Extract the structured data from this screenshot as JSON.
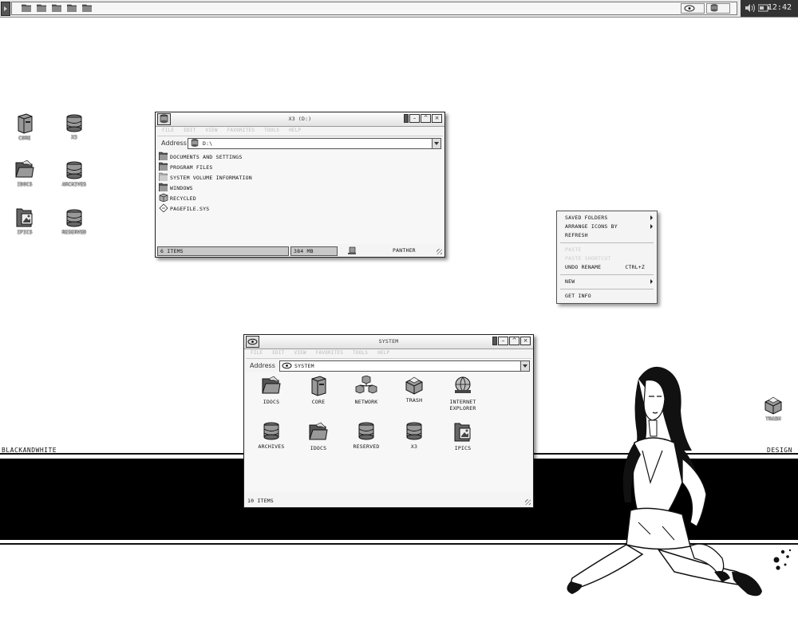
{
  "taskbar": {
    "quick_launch_icons": [
      "folder-icon",
      "folder-icon",
      "folder-icon",
      "folder-icon",
      "folder-icon"
    ],
    "clock": "12:42"
  },
  "desktop_icons": [
    {
      "label": "CORE",
      "icon": "computer-icon"
    },
    {
      "label": "X3",
      "icon": "drive-icon"
    },
    {
      "label": "IDOCS",
      "icon": "folder-open-icon"
    },
    {
      "label": "ARCHIVES",
      "icon": "drive-icon"
    },
    {
      "label": "IPICS",
      "icon": "pictures-icon"
    },
    {
      "label": "RESERVED",
      "icon": "drive-icon"
    },
    {
      "label": "TRASH",
      "icon": "trash-icon"
    }
  ],
  "branding": {
    "left": "BLACKANDWHITE",
    "right": "DESIGN"
  },
  "win_drive": {
    "title": "X3 (D:)",
    "menu": [
      "FILE",
      "EDIT",
      "VIEW",
      "FAVORITES",
      "TOOLS",
      "HELP"
    ],
    "address_label": "Address",
    "address": "D:\\",
    "items": [
      {
        "name": "DOCUMENTS AND SETTINGS",
        "icon": "folder-icon"
      },
      {
        "name": "PROGRAM FILES",
        "icon": "folder-icon"
      },
      {
        "name": "SYSTEM VOLUME INFORMATION",
        "icon": "folder-icon"
      },
      {
        "name": "WINDOWS",
        "icon": "folder-icon"
      },
      {
        "name": "RECYCLED",
        "icon": "recycle-icon"
      },
      {
        "name": "PAGEFILE.SYS",
        "icon": "file-icon"
      }
    ],
    "status": {
      "count": "6 ITEMS",
      "size": "384 MB",
      "zone": "PANTHER"
    }
  },
  "win_system": {
    "title": "SYSTEM",
    "menu": [
      "FILE",
      "EDIT",
      "VIEW",
      "FAVORITES",
      "TOOLS",
      "HELP"
    ],
    "address_label": "Address",
    "address": "SYSTEM",
    "items": [
      {
        "name": "IDOCS",
        "icon": "folder-open-icon"
      },
      {
        "name": "CORE",
        "icon": "computer-icon"
      },
      {
        "name": "NETWORK",
        "icon": "network-icon"
      },
      {
        "name": "TRASH",
        "icon": "trash-icon"
      },
      {
        "name": "INTERNET EXPLORER",
        "icon": "globe-icon"
      },
      {
        "name": "ARCHIVES",
        "icon": "drive-icon"
      },
      {
        "name": "IDOCS",
        "icon": "folder-open-icon"
      },
      {
        "name": "RESERVED",
        "icon": "drive-icon"
      },
      {
        "name": "X3",
        "icon": "drive-icon"
      },
      {
        "name": "IPICS",
        "icon": "pictures-icon"
      }
    ],
    "status": {
      "count": "10 ITEMS"
    }
  },
  "context_menu": {
    "items": [
      {
        "label": "SAVED FOLDERS",
        "submenu": true,
        "enabled": true
      },
      {
        "label": "ARRANGE ICONS BY",
        "submenu": true,
        "enabled": true
      },
      {
        "label": "REFRESH",
        "enabled": true
      },
      {
        "label": "PASTE",
        "enabled": false
      },
      {
        "label": "PASTE SHORTCUT",
        "enabled": false
      },
      {
        "label": "UNDO RENAME",
        "shortcut": "CTRL+Z",
        "enabled": true
      },
      {
        "label": "NEW",
        "submenu": true,
        "enabled": true
      },
      {
        "label": "GET INFO",
        "enabled": true
      }
    ]
  },
  "colors": {
    "background": "#ffffff",
    "ink": "#111111",
    "band": "#000000",
    "window": "#f4f4f4"
  }
}
